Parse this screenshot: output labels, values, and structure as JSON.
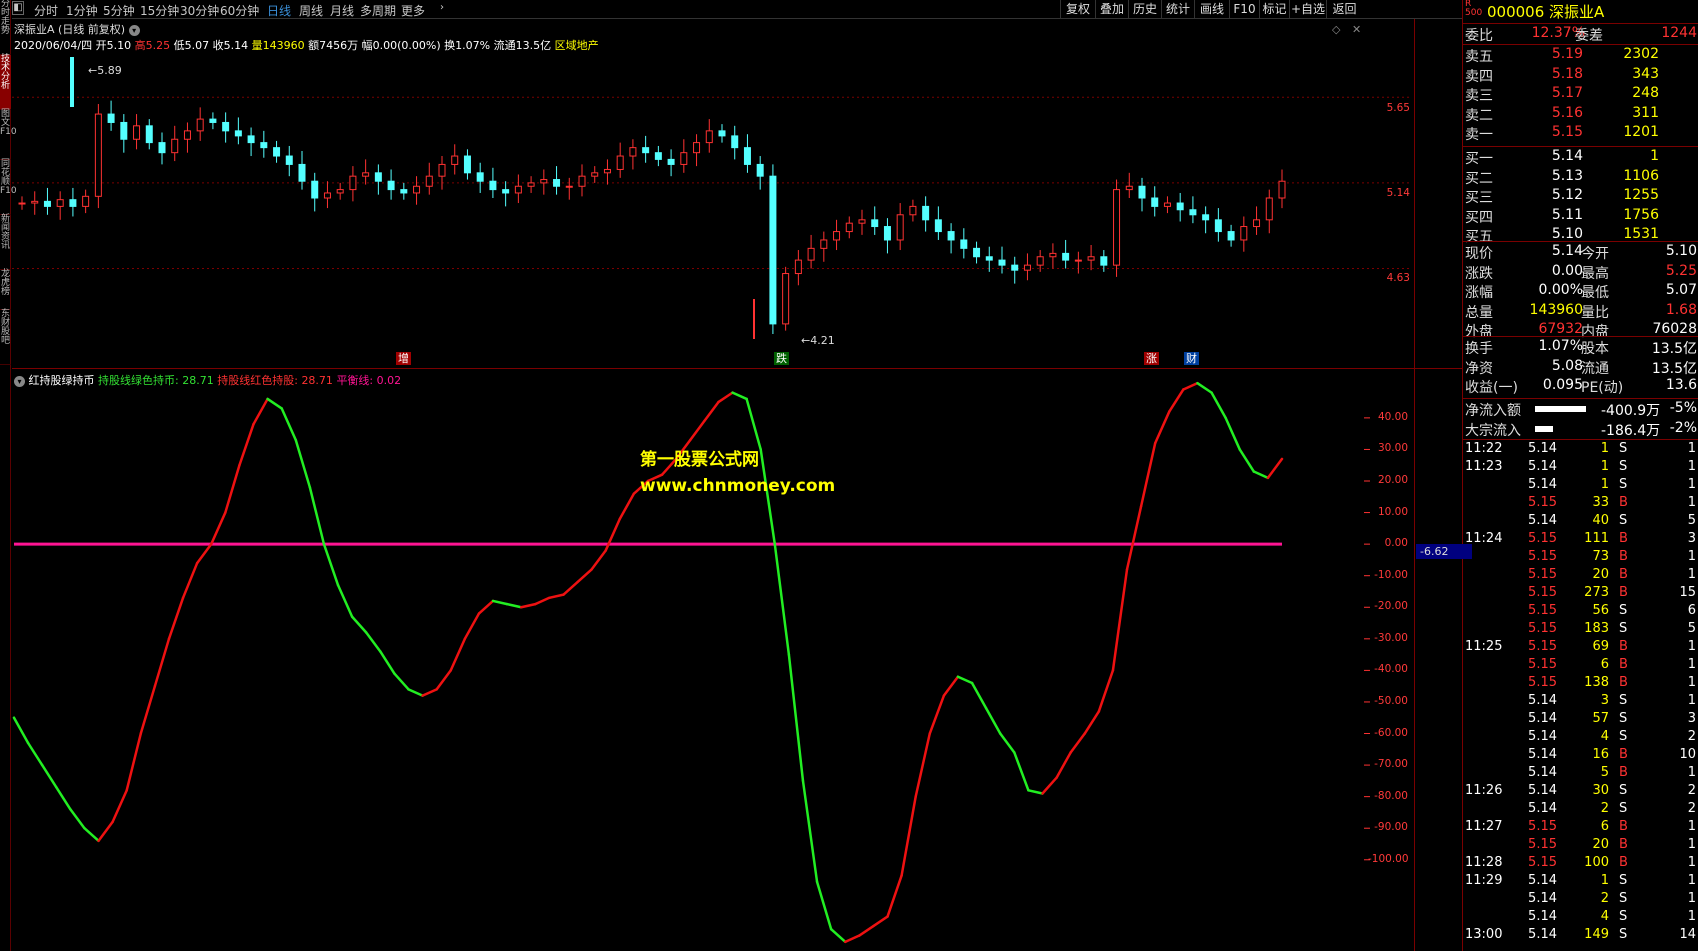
{
  "left_tabs": [
    {
      "label": "分时走势",
      "selected": false
    },
    {
      "label": "技术分析",
      "selected": true
    },
    {
      "label": "图文F10",
      "selected": false
    },
    {
      "label": "同花顺F10",
      "selected": false
    },
    {
      "label": "新闻资讯",
      "selected": false
    },
    {
      "label": "龙虎榜",
      "selected": false
    },
    {
      "label": "东财股吧",
      "selected": false
    }
  ],
  "toolbar": {
    "periods": [
      "分时",
      "1分钟",
      "5分钟",
      "15分钟",
      "30分钟",
      "60分钟",
      "日线",
      "周线",
      "月线",
      "多周期",
      "更多"
    ],
    "active_period": "日线",
    "right_buttons": [
      "复权",
      "叠加",
      "历史",
      "统计",
      "画线",
      "F10",
      "标记",
      "+自选",
      "返回"
    ]
  },
  "kline": {
    "title": "深振业A (日线 前复权)",
    "date": "2020/06/04/四",
    "open_label": "开",
    "open": "5.10",
    "high_label": "高",
    "high": "5.25",
    "low_label": "低",
    "low": "5.07",
    "close_label": "收",
    "close": "5.14",
    "vol_label": "量",
    "volume": "143960",
    "amt_label": "额",
    "amount": "7456万",
    "chg_label": "幅",
    "change": "0.00(0.00%)",
    "turn_label": "换",
    "turnover": "1.07%",
    "float_label": "流通",
    "float": "13.5亿",
    "sector": "区域地产",
    "max_note": "5.89",
    "min_note": "←4.21",
    "ticks": [
      "5.65",
      "5.14",
      "4.63"
    ],
    "markers": [
      "增",
      "跌",
      "涨",
      "财"
    ]
  },
  "indicator": {
    "name": "红持股绿持币",
    "l1_label": "持股线绿色持币:",
    "l1_val": "28.71",
    "l2_label": "持股线红色持股:",
    "l2_val": "28.71",
    "l3_label": "平衡线:",
    "l3_val": "0.02",
    "ticks": [
      "40.00",
      "30.00",
      "20.00",
      "10.00",
      "0.00",
      "-10.00",
      "-20.00",
      "-30.00",
      "-40.00",
      "-50.00",
      "-60.00",
      "-70.00",
      "-80.00",
      "-90.00",
      "-100.00"
    ],
    "cursor_value": "-6.62",
    "watermark1": "第一股票公式网",
    "watermark2": "www.chnmoney.com"
  },
  "quote": {
    "code": "000006",
    "name": "深振业A",
    "r_label": "R",
    "r_sub": "500",
    "webi_label": "委比",
    "webi": "12.37%",
    "weicha_label": "委差",
    "weicha": "1244",
    "asks": [
      {
        "label": "卖五",
        "price": "5.19",
        "vol": "2302"
      },
      {
        "label": "卖四",
        "price": "5.18",
        "vol": "343"
      },
      {
        "label": "卖三",
        "price": "5.17",
        "vol": "248"
      },
      {
        "label": "卖二",
        "price": "5.16",
        "vol": "311"
      },
      {
        "label": "卖一",
        "price": "5.15",
        "vol": "1201"
      }
    ],
    "bids": [
      {
        "label": "买一",
        "price": "5.14",
        "vol": "1"
      },
      {
        "label": "买二",
        "price": "5.13",
        "vol": "1106"
      },
      {
        "label": "买三",
        "price": "5.12",
        "vol": "1255"
      },
      {
        "label": "买四",
        "price": "5.11",
        "vol": "1756"
      },
      {
        "label": "买五",
        "price": "5.10",
        "vol": "1531"
      }
    ],
    "stats": [
      {
        "l1": "现价",
        "v1": "5.14",
        "c1": "wht",
        "l2": "今开",
        "v2": "5.10",
        "c2": "wht"
      },
      {
        "l1": "涨跌",
        "v1": "0.00",
        "c1": "wht",
        "l2": "最高",
        "v2": "5.25",
        "c2": "red"
      },
      {
        "l1": "涨幅",
        "v1": "0.00%",
        "c1": "wht",
        "l2": "最低",
        "v2": "5.07",
        "c2": "wht"
      },
      {
        "l1": "总量",
        "v1": "143960",
        "c1": "yel",
        "l2": "量比",
        "v2": "1.68",
        "c2": "red"
      },
      {
        "l1": "外盘",
        "v1": "67932",
        "c1": "red",
        "l2": "内盘",
        "v2": "76028",
        "c2": "wht"
      }
    ],
    "stats2": [
      {
        "l1": "换手",
        "v1": "1.07%",
        "l2": "股本",
        "v2": "13.5亿"
      },
      {
        "l1": "净资",
        "v1": "5.08",
        "l2": "流通",
        "v2": "13.5亿"
      },
      {
        "l1": "收益(一)",
        "v1": "0.095",
        "l2": "PE(动)",
        "v2": "13.6"
      }
    ],
    "flows": [
      {
        "label": "净流入额",
        "value": "-400.9万",
        "pct": "-5%",
        "bar": 0.85
      },
      {
        "label": "大宗流入",
        "value": "-186.4万",
        "pct": "-2%",
        "bar": 0.3
      }
    ],
    "ticks": [
      {
        "t": "11:22",
        "p": "5.14",
        "pc": "wht",
        "v": "1",
        "d": "S",
        "n": "1"
      },
      {
        "t": "11:23",
        "p": "5.14",
        "pc": "wht",
        "v": "1",
        "d": "S",
        "n": "1"
      },
      {
        "t": "",
        "p": "5.14",
        "pc": "wht",
        "v": "1",
        "d": "S",
        "n": "1"
      },
      {
        "t": "",
        "p": "5.15",
        "pc": "red",
        "v": "33",
        "d": "B",
        "n": "1"
      },
      {
        "t": "",
        "p": "5.14",
        "pc": "wht",
        "v": "40",
        "d": "S",
        "n": "5"
      },
      {
        "t": "11:24",
        "p": "5.15",
        "pc": "red",
        "v": "111",
        "d": "B",
        "n": "3"
      },
      {
        "t": "",
        "p": "5.15",
        "pc": "red",
        "v": "73",
        "d": "B",
        "n": "1"
      },
      {
        "t": "",
        "p": "5.15",
        "pc": "red",
        "v": "20",
        "d": "B",
        "n": "1"
      },
      {
        "t": "",
        "p": "5.15",
        "pc": "red",
        "v": "273",
        "d": "B",
        "n": "15"
      },
      {
        "t": "",
        "p": "5.15",
        "pc": "red",
        "v": "56",
        "d": "S",
        "n": "6"
      },
      {
        "t": "",
        "p": "5.15",
        "pc": "red",
        "v": "183",
        "d": "S",
        "n": "5"
      },
      {
        "t": "11:25",
        "p": "5.15",
        "pc": "red",
        "v": "69",
        "d": "B",
        "n": "1"
      },
      {
        "t": "",
        "p": "5.15",
        "pc": "red",
        "v": "6",
        "d": "B",
        "n": "1"
      },
      {
        "t": "",
        "p": "5.15",
        "pc": "red",
        "v": "138",
        "d": "B",
        "n": "1"
      },
      {
        "t": "",
        "p": "5.14",
        "pc": "wht",
        "v": "3",
        "d": "S",
        "n": "1"
      },
      {
        "t": "",
        "p": "5.14",
        "pc": "wht",
        "v": "57",
        "d": "S",
        "n": "3"
      },
      {
        "t": "",
        "p": "5.14",
        "pc": "wht",
        "v": "4",
        "d": "S",
        "n": "2"
      },
      {
        "t": "",
        "p": "5.14",
        "pc": "wht",
        "v": "16",
        "d": "B",
        "n": "10"
      },
      {
        "t": "",
        "p": "5.14",
        "pc": "wht",
        "v": "5",
        "d": "B",
        "n": "1"
      },
      {
        "t": "11:26",
        "p": "5.14",
        "pc": "wht",
        "v": "30",
        "d": "S",
        "n": "2"
      },
      {
        "t": "",
        "p": "5.14",
        "pc": "wht",
        "v": "2",
        "d": "S",
        "n": "2"
      },
      {
        "t": "11:27",
        "p": "5.15",
        "pc": "red",
        "v": "6",
        "d": "B",
        "n": "1"
      },
      {
        "t": "",
        "p": "5.15",
        "pc": "red",
        "v": "20",
        "d": "B",
        "n": "1"
      },
      {
        "t": "11:28",
        "p": "5.15",
        "pc": "red",
        "v": "100",
        "d": "B",
        "n": "1"
      },
      {
        "t": "11:29",
        "p": "5.14",
        "pc": "wht",
        "v": "1",
        "d": "S",
        "n": "1"
      },
      {
        "t": "",
        "p": "5.14",
        "pc": "wht",
        "v": "2",
        "d": "S",
        "n": "1"
      },
      {
        "t": "",
        "p": "5.14",
        "pc": "wht",
        "v": "4",
        "d": "S",
        "n": "1"
      },
      {
        "t": "13:00",
        "p": "5.14",
        "pc": "wht",
        "v": "149",
        "d": "S",
        "n": "14"
      }
    ]
  },
  "colors": {
    "up": "#ff3232",
    "down": "#54ffff",
    "line_green": "#22ee22",
    "line_red": "#ee1111",
    "balance": "#ff1493",
    "grid": "#7a0000"
  },
  "chart_data": [
    {
      "type": "candlestick",
      "title": "深振业A (日线 前复权)",
      "ylim": [
        4.21,
        5.89
      ],
      "y_ticks": [
        5.65,
        5.14,
        4.63
      ],
      "annotations": {
        "max": 5.89,
        "min": 4.21
      }
    },
    {
      "type": "line",
      "title": "红持股绿持币",
      "ylim": [
        -127,
        52
      ],
      "series": [
        {
          "name": "持股线",
          "values": [
            -55,
            -63,
            -70,
            -77,
            -84,
            -90,
            -94,
            -88,
            -78,
            -60,
            -45,
            -30,
            -17,
            -6,
            0,
            10,
            25,
            38,
            46,
            43,
            33,
            18,
            0,
            -13,
            -23,
            -28,
            -34,
            -41,
            -46,
            -48,
            -46,
            -40,
            -30,
            -22,
            -18,
            -19,
            -20,
            -19,
            -17,
            -16,
            -12,
            -8,
            -2,
            8,
            16,
            20,
            22,
            27,
            33,
            39,
            45,
            48,
            46,
            30,
            0,
            -35,
            -75,
            -107,
            -122,
            -126,
            -124,
            -121,
            -118,
            -105,
            -80,
            -60,
            -48,
            -42,
            -44,
            -52,
            -60,
            -66,
            -78,
            -79,
            -74,
            -66,
            -60,
            -53,
            -40,
            -8,
            12,
            32,
            42,
            49,
            51,
            48,
            40,
            30,
            23,
            21,
            27
          ]
        },
        {
          "name": "平衡线",
          "values": [
            0,
            0,
            0,
            0,
            0,
            0,
            0,
            0,
            0,
            0,
            0,
            0,
            0,
            0,
            0,
            0,
            0,
            0,
            0,
            0,
            0,
            0,
            0,
            0,
            0,
            0,
            0,
            0,
            0,
            0,
            0,
            0,
            0,
            0,
            0,
            0,
            0,
            0,
            0,
            0,
            0,
            0,
            0,
            0,
            0,
            0,
            0,
            0,
            0,
            0,
            0,
            0,
            0,
            0,
            0,
            0,
            0,
            0,
            0,
            0,
            0,
            0,
            0,
            0,
            0,
            0,
            0,
            0,
            0,
            0,
            0,
            0,
            0,
            0,
            0,
            0,
            0,
            0,
            0,
            0,
            0,
            0,
            0,
            0,
            0,
            0,
            0,
            0,
            0,
            0,
            0
          ]
        }
      ]
    }
  ]
}
